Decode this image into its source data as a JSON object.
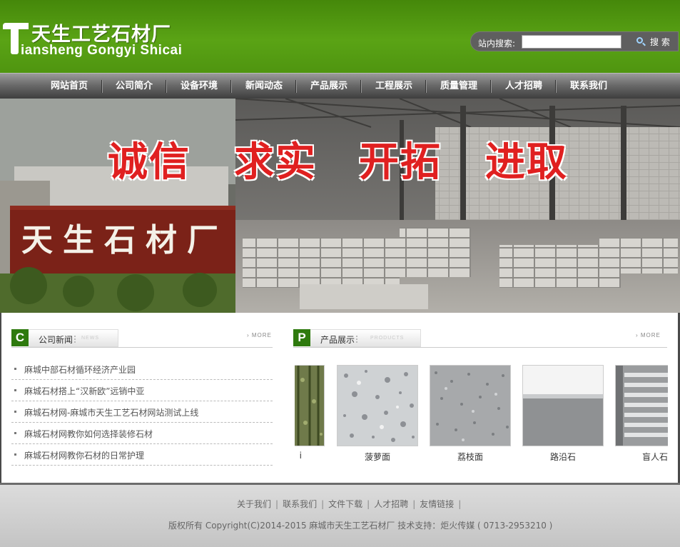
{
  "header": {
    "logo_letter": "T",
    "logo_cn": "天生工艺石材厂",
    "logo_en": "iansheng Gongyi Shicai",
    "search": {
      "label": "站内搜索:",
      "value": "",
      "placeholder": "",
      "button_label": "搜 索",
      "button_icon": "search-icon"
    }
  },
  "nav": {
    "items": [
      {
        "label": "网站首页"
      },
      {
        "label": "公司简介"
      },
      {
        "label": "设备环境"
      },
      {
        "label": "新闻动态"
      },
      {
        "label": "产品展示"
      },
      {
        "label": "工程展示"
      },
      {
        "label": "质量管理"
      },
      {
        "label": "人才招聘"
      },
      {
        "label": "联系我们"
      }
    ]
  },
  "banner": {
    "slogans": [
      "诚信",
      "求实",
      "开拓",
      "进取"
    ],
    "sign_text": "天生石材厂"
  },
  "news": {
    "badge": "C",
    "title": "公司新闻",
    "title_en": "NEWS",
    "more": "MORE",
    "items": [
      {
        "text": "麻城中部石材循环经济产业园"
      },
      {
        "text": "麻城石材搭上“汉新欧”远销中亚"
      },
      {
        "text": "麻城石材网-麻城市天生工艺石材网站测试上线"
      },
      {
        "text": "麻城石材网教你如何选择装修石材"
      },
      {
        "text": "麻城石材网教你石材的日常护理"
      }
    ]
  },
  "products": {
    "badge": "P",
    "title": "产品展示",
    "title_en": "PRODUCTS",
    "more": "MORE",
    "items": [
      {
        "name": "i"
      },
      {
        "name": "菠萝面"
      },
      {
        "name": "荔枝面"
      },
      {
        "name": "路沿石"
      },
      {
        "name": "盲人石"
      }
    ]
  },
  "footer": {
    "links": [
      "关于我们",
      "联系我们",
      "文件下载",
      "人才招聘",
      "友情链接"
    ],
    "pipe": "|",
    "copyright": "版权所有 Copyright(C)2014-2015 麻城市天生工艺石材厂  技术支持：炬火传媒 ( 0713-2953210 )"
  },
  "colors": {
    "header_green": "#5aa315",
    "nav_gray": "#6b6b6b",
    "badge_green": "#2e7a0e",
    "slogan_red": "#e02020"
  }
}
